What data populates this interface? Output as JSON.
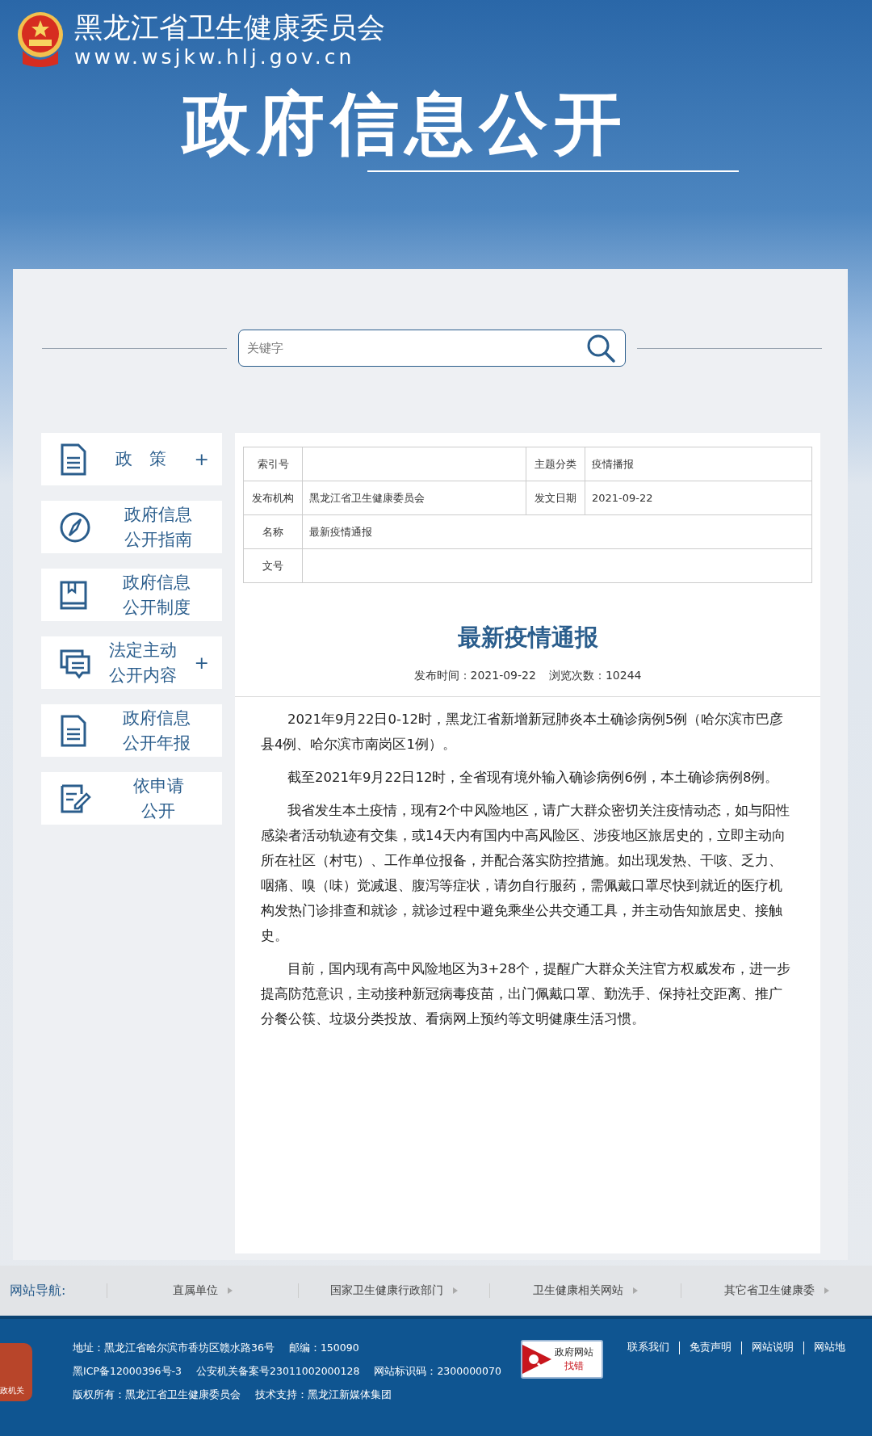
{
  "header": {
    "title": "黑龙江省卫生健康委员会",
    "url": "www.wsjkw.hlj.gov.cn",
    "banner": "政府信息公开"
  },
  "search": {
    "placeholder": "关键字"
  },
  "sidebar": {
    "items": [
      {
        "kind": "document",
        "lines": [
          "政　策"
        ],
        "toggle": "+"
      },
      {
        "kind": "compass",
        "lines": [
          "政府信息",
          "公开指南"
        ]
      },
      {
        "kind": "book",
        "lines": [
          "政府信息",
          "公开制度"
        ]
      },
      {
        "kind": "chat",
        "lines": [
          "法定主动",
          "公开内容"
        ],
        "toggle": "+"
      },
      {
        "kind": "document",
        "lines": [
          "政府信息",
          "公开年报"
        ]
      },
      {
        "kind": "edit",
        "lines": [
          "依申请",
          "公开"
        ]
      }
    ]
  },
  "info_table": {
    "rows": [
      {
        "cells": [
          {
            "label": "索引号"
          },
          {
            "label": "主题分类",
            "value": "疫情播报"
          }
        ]
      },
      {
        "cells": [
          {
            "label": "发布机构",
            "value": "黑龙江省卫生健康委员会"
          },
          {
            "label": "发文日期",
            "value": "2021-09-22"
          }
        ]
      },
      {
        "cells": [
          {
            "label": "名称",
            "value": "最新疫情通报"
          }
        ]
      },
      {
        "cells": [
          {
            "label": "文号"
          }
        ]
      }
    ]
  },
  "article": {
    "title": "最新疫情通报",
    "publish_time": "发布时间：2021-09-22",
    "views": "浏览次数：10244",
    "paragraphs": [
      "2021年9月22日0-12时，黑龙江省新增新冠肺炎本土确诊病例5例（哈尔滨市巴彦县4例、哈尔滨市南岗区1例）。",
      "截至2021年9月22日12时，全省现有境外输入确诊病例6例，本土确诊病例8例。",
      "我省发生本土疫情，现有2个中风险地区，请广大群众密切关注疫情动态，如与阳性感染者活动轨迹有交集，或14天内有国内中高风险区、涉疫地区旅居史的，立即主动向所在社区（村屯）、工作单位报备，并配合落实防控措施。如出现发热、干咳、乏力、咽痛、嗅（味）觉减退、腹泻等症状，请勿自行服药，需佩戴口罩尽快到就近的医疗机构发热门诊排查和就诊，就诊过程中避免乘坐公共交通工具，并主动告知旅居史、接触史。",
      "目前，国内现有高中风险地区为3+28个，提醒广大群众关注官方权威发布，进一步提高防范意识，主动接种新冠病毒疫苗，出门佩戴口罩、勤洗手、保持社交距离、推广分餐公筷、垃圾分类投放、看病网上预约等文明健康生活习惯。"
    ]
  },
  "site_nav": {
    "label": "网站导航:",
    "items": [
      "直属单位",
      "国家卫生健康行政部门",
      "卫生健康相关网站",
      "其它省卫生健康委"
    ]
  },
  "footer": {
    "badge": "政机关",
    "lines": [
      [
        "地址：黑龙江省哈尔滨市香坊区赣水路36号",
        "邮编：150090"
      ],
      [
        "黑ICP备12000396号-3",
        "公安机关备案号23011002000128",
        "网站标识码：2300000070"
      ],
      [
        "版权所有：黑龙江省卫生健康委员会",
        "技术支持：黑龙江新媒体集团"
      ]
    ],
    "report": [
      "政府网站",
      "找错"
    ],
    "links": [
      "联系我们",
      "免责声明",
      "网站说明",
      "网站地"
    ]
  }
}
